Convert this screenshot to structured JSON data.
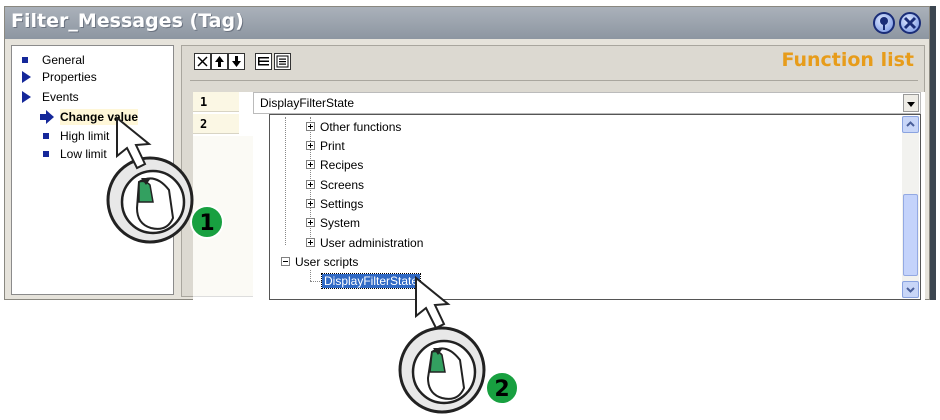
{
  "window": {
    "title": "Filter_Messages (Tag)",
    "pin_icon": "pin-icon",
    "close_icon": "close-icon"
  },
  "tree": {
    "items": [
      {
        "label": "General",
        "icon": "square-bullet"
      },
      {
        "label": "Properties",
        "icon": "triangle-bullet"
      },
      {
        "label": "Events",
        "icon": "triangle-bullet"
      },
      {
        "label": "Change value",
        "icon": "arrow-bullet",
        "selected": true
      },
      {
        "label": "High limit",
        "icon": "square-bullet"
      },
      {
        "label": "Low limit",
        "icon": "square-bullet"
      }
    ]
  },
  "toolbar": {
    "buttons": [
      "delete-icon",
      "move-up-icon",
      "move-down-icon",
      "indent-icon",
      "list-icon"
    ]
  },
  "panel": {
    "title": "Function list"
  },
  "grid": {
    "rows": [
      "1",
      "2"
    ],
    "row1_value": "DisplayFilterState"
  },
  "dropdown": {
    "items": [
      {
        "label": "Other functions",
        "expander": "plus"
      },
      {
        "label": "Print",
        "expander": "plus"
      },
      {
        "label": "Recipes",
        "expander": "plus"
      },
      {
        "label": "Screens",
        "expander": "plus"
      },
      {
        "label": "Settings",
        "expander": "plus"
      },
      {
        "label": "System",
        "expander": "plus"
      },
      {
        "label": "User administration",
        "expander": "plus"
      },
      {
        "label": "User scripts",
        "expander": "minus"
      },
      {
        "label": "DisplayFilterState",
        "selected": true
      }
    ]
  },
  "callouts": [
    {
      "number": "1",
      "icon": "mouse-icon"
    },
    {
      "number": "2",
      "icon": "mouse-icon"
    }
  ],
  "colors": {
    "accent": "#e79c1a",
    "selection": "#316ac5",
    "tree_bullet": "#15289a",
    "callout_green": "#18a040"
  }
}
